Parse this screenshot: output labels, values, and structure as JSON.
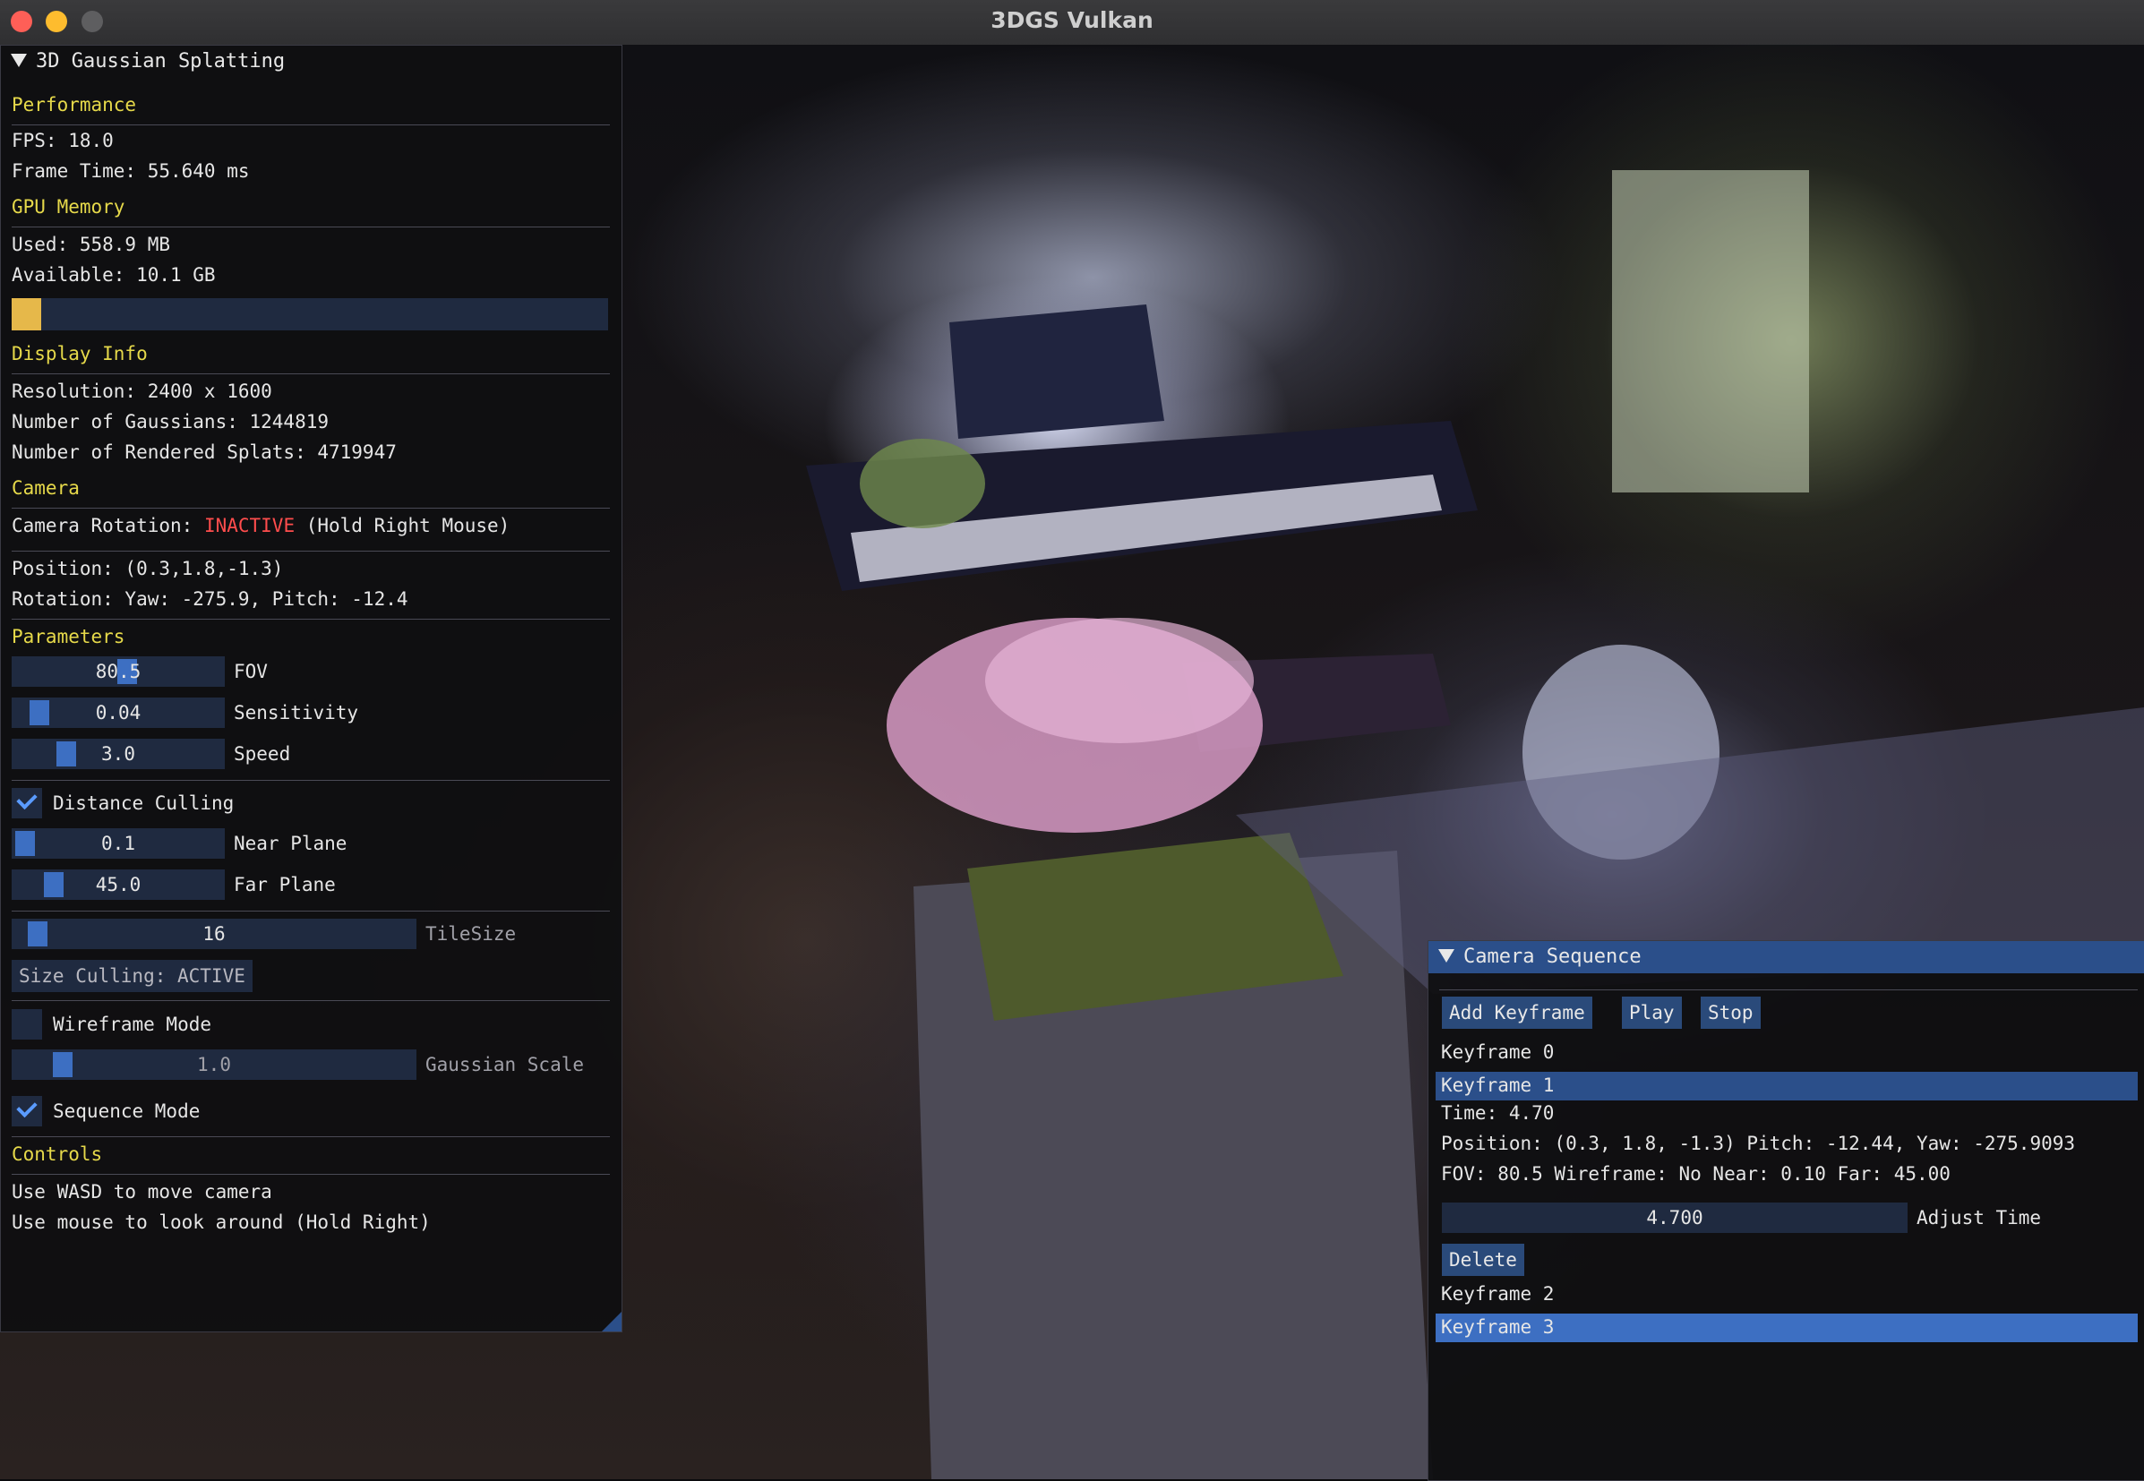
{
  "window": {
    "title": "3DGS Vulkan"
  },
  "main_panel": {
    "header": "3D Gaussian Splatting",
    "performance": {
      "title": "Performance",
      "fps": "FPS: 18.0",
      "frame_time": "Frame Time: 55.640 ms"
    },
    "gpu_memory": {
      "title": "GPU Memory",
      "used": "Used: 558.9 MB",
      "available": "Available: 10.1 GB",
      "usage_fraction": 0.05
    },
    "display_info": {
      "title": "Display Info",
      "resolution": "Resolution: 2400 x 1600",
      "gaussians": "Number of Gaussians: 1244819",
      "rendered_splats": "Number of Rendered Splats: 4719947"
    },
    "camera": {
      "title": "Camera",
      "rotation_label": "Camera Rotation: ",
      "rotation_state": "INACTIVE",
      "rotation_hint": " (Hold Right Mouse)",
      "position": "Position: (0.3,1.8,-1.3)",
      "rotation": "Rotation: Yaw: -275.9, Pitch: -12.4"
    },
    "parameters": {
      "title": "Parameters",
      "fov": {
        "value": "80.5",
        "label": "FOV"
      },
      "sensitivity": {
        "value": "0.04",
        "label": "Sensitivity"
      },
      "speed": {
        "value": "3.0",
        "label": "Speed"
      },
      "distance_culling": {
        "label": "Distance Culling",
        "checked": true
      },
      "near_plane": {
        "value": "0.1",
        "label": "Near Plane"
      },
      "far_plane": {
        "value": "45.0",
        "label": "Far Plane"
      },
      "tile_size": {
        "value": "16",
        "label": "TileSize"
      },
      "size_culling_button": "Size Culling: ACTIVE",
      "wireframe": {
        "label": "Wireframe Mode",
        "checked": false
      },
      "gaussian_scale": {
        "value": "1.0",
        "label": "Gaussian Scale"
      },
      "sequence_mode": {
        "label": "Sequence Mode",
        "checked": true
      }
    },
    "controls": {
      "title": "Controls",
      "line1": "Use WASD to move camera",
      "line2": "Use mouse to look around (Hold Right)"
    }
  },
  "sequence_panel": {
    "header": "Camera Sequence",
    "add_button": "Add Keyframe",
    "play_button": "Play",
    "stop_button": "Stop",
    "keyframes": [
      "Keyframe 0",
      "Keyframe 1",
      "Keyframe 2",
      "Keyframe 3"
    ],
    "selected_detail": {
      "time": "Time: 4.70",
      "position": "Position: (0.3, 1.8, -1.3) Pitch: -12.44, Yaw: -275.9093",
      "fov": "FOV: 80.5 Wireframe: No Near: 0.10 Far: 45.00",
      "adjust_value": "4.700",
      "adjust_label": "Adjust Time",
      "delete_button": "Delete"
    }
  },
  "colors": {
    "section_heading": "#e6d94a",
    "inactive": "#ff4d4d",
    "accent": "#3d6fc2",
    "selection": "#3d6fc2"
  }
}
